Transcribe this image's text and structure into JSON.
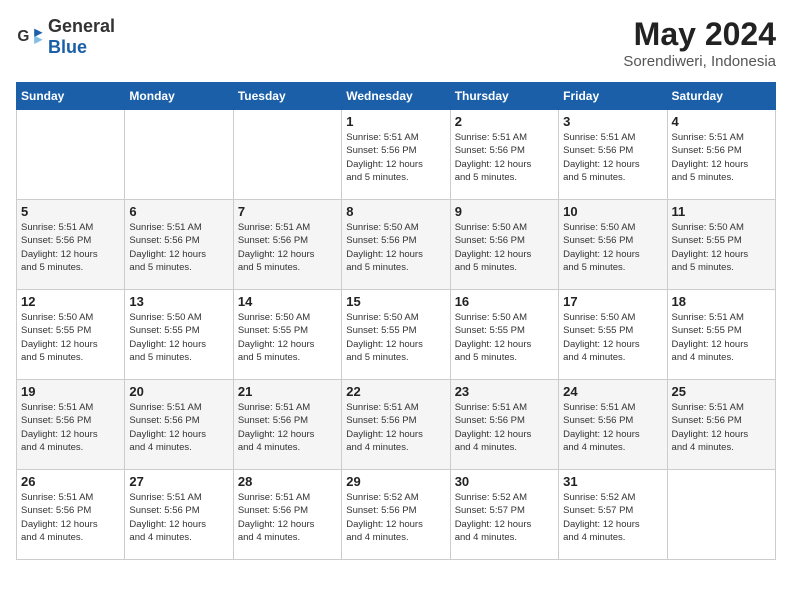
{
  "logo": {
    "general": "General",
    "blue": "Blue"
  },
  "title": {
    "month_year": "May 2024",
    "location": "Sorendiweri, Indonesia"
  },
  "headers": [
    "Sunday",
    "Monday",
    "Tuesday",
    "Wednesday",
    "Thursday",
    "Friday",
    "Saturday"
  ],
  "weeks": [
    [
      {
        "day": "",
        "info": ""
      },
      {
        "day": "",
        "info": ""
      },
      {
        "day": "",
        "info": ""
      },
      {
        "day": "1",
        "info": "Sunrise: 5:51 AM\nSunset: 5:56 PM\nDaylight: 12 hours\nand 5 minutes."
      },
      {
        "day": "2",
        "info": "Sunrise: 5:51 AM\nSunset: 5:56 PM\nDaylight: 12 hours\nand 5 minutes."
      },
      {
        "day": "3",
        "info": "Sunrise: 5:51 AM\nSunset: 5:56 PM\nDaylight: 12 hours\nand 5 minutes."
      },
      {
        "day": "4",
        "info": "Sunrise: 5:51 AM\nSunset: 5:56 PM\nDaylight: 12 hours\nand 5 minutes."
      }
    ],
    [
      {
        "day": "5",
        "info": "Sunrise: 5:51 AM\nSunset: 5:56 PM\nDaylight: 12 hours\nand 5 minutes."
      },
      {
        "day": "6",
        "info": "Sunrise: 5:51 AM\nSunset: 5:56 PM\nDaylight: 12 hours\nand 5 minutes."
      },
      {
        "day": "7",
        "info": "Sunrise: 5:51 AM\nSunset: 5:56 PM\nDaylight: 12 hours\nand 5 minutes."
      },
      {
        "day": "8",
        "info": "Sunrise: 5:50 AM\nSunset: 5:56 PM\nDaylight: 12 hours\nand 5 minutes."
      },
      {
        "day": "9",
        "info": "Sunrise: 5:50 AM\nSunset: 5:56 PM\nDaylight: 12 hours\nand 5 minutes."
      },
      {
        "day": "10",
        "info": "Sunrise: 5:50 AM\nSunset: 5:56 PM\nDaylight: 12 hours\nand 5 minutes."
      },
      {
        "day": "11",
        "info": "Sunrise: 5:50 AM\nSunset: 5:55 PM\nDaylight: 12 hours\nand 5 minutes."
      }
    ],
    [
      {
        "day": "12",
        "info": "Sunrise: 5:50 AM\nSunset: 5:55 PM\nDaylight: 12 hours\nand 5 minutes."
      },
      {
        "day": "13",
        "info": "Sunrise: 5:50 AM\nSunset: 5:55 PM\nDaylight: 12 hours\nand 5 minutes."
      },
      {
        "day": "14",
        "info": "Sunrise: 5:50 AM\nSunset: 5:55 PM\nDaylight: 12 hours\nand 5 minutes."
      },
      {
        "day": "15",
        "info": "Sunrise: 5:50 AM\nSunset: 5:55 PM\nDaylight: 12 hours\nand 5 minutes."
      },
      {
        "day": "16",
        "info": "Sunrise: 5:50 AM\nSunset: 5:55 PM\nDaylight: 12 hours\nand 5 minutes."
      },
      {
        "day": "17",
        "info": "Sunrise: 5:50 AM\nSunset: 5:55 PM\nDaylight: 12 hours\nand 4 minutes."
      },
      {
        "day": "18",
        "info": "Sunrise: 5:51 AM\nSunset: 5:55 PM\nDaylight: 12 hours\nand 4 minutes."
      }
    ],
    [
      {
        "day": "19",
        "info": "Sunrise: 5:51 AM\nSunset: 5:56 PM\nDaylight: 12 hours\nand 4 minutes."
      },
      {
        "day": "20",
        "info": "Sunrise: 5:51 AM\nSunset: 5:56 PM\nDaylight: 12 hours\nand 4 minutes."
      },
      {
        "day": "21",
        "info": "Sunrise: 5:51 AM\nSunset: 5:56 PM\nDaylight: 12 hours\nand 4 minutes."
      },
      {
        "day": "22",
        "info": "Sunrise: 5:51 AM\nSunset: 5:56 PM\nDaylight: 12 hours\nand 4 minutes."
      },
      {
        "day": "23",
        "info": "Sunrise: 5:51 AM\nSunset: 5:56 PM\nDaylight: 12 hours\nand 4 minutes."
      },
      {
        "day": "24",
        "info": "Sunrise: 5:51 AM\nSunset: 5:56 PM\nDaylight: 12 hours\nand 4 minutes."
      },
      {
        "day": "25",
        "info": "Sunrise: 5:51 AM\nSunset: 5:56 PM\nDaylight: 12 hours\nand 4 minutes."
      }
    ],
    [
      {
        "day": "26",
        "info": "Sunrise: 5:51 AM\nSunset: 5:56 PM\nDaylight: 12 hours\nand 4 minutes."
      },
      {
        "day": "27",
        "info": "Sunrise: 5:51 AM\nSunset: 5:56 PM\nDaylight: 12 hours\nand 4 minutes."
      },
      {
        "day": "28",
        "info": "Sunrise: 5:51 AM\nSunset: 5:56 PM\nDaylight: 12 hours\nand 4 minutes."
      },
      {
        "day": "29",
        "info": "Sunrise: 5:52 AM\nSunset: 5:56 PM\nDaylight: 12 hours\nand 4 minutes."
      },
      {
        "day": "30",
        "info": "Sunrise: 5:52 AM\nSunset: 5:57 PM\nDaylight: 12 hours\nand 4 minutes."
      },
      {
        "day": "31",
        "info": "Sunrise: 5:52 AM\nSunset: 5:57 PM\nDaylight: 12 hours\nand 4 minutes."
      },
      {
        "day": "",
        "info": ""
      }
    ]
  ]
}
